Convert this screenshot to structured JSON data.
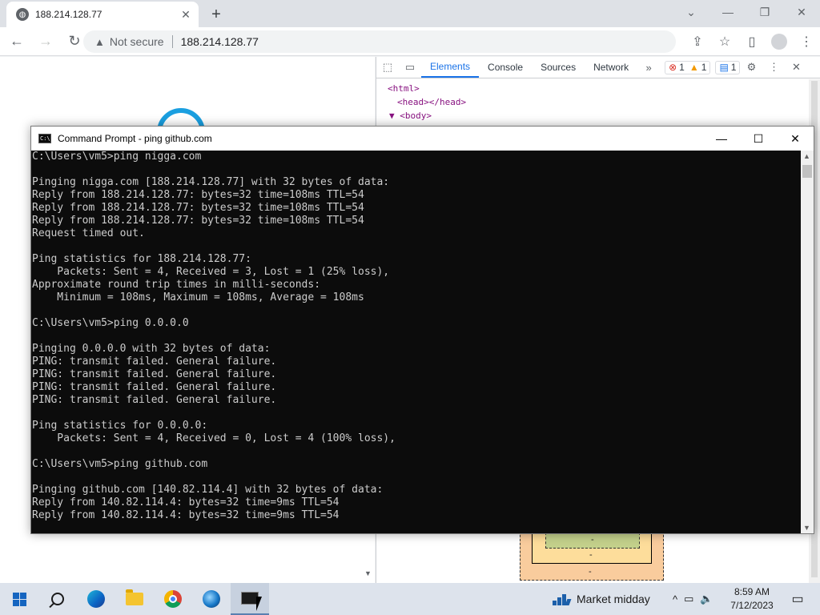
{
  "browser": {
    "tab_title": "188.214.128.77",
    "tab_close_glyph": "✕",
    "new_tab_glyph": "+",
    "window_controls": [
      "⌄",
      "—",
      "❐",
      "✕"
    ],
    "not_secure_label": "Not secure",
    "url": "188.214.128.77",
    "back_glyph": "←",
    "forward_glyph": "→",
    "reload_glyph": "↻",
    "warning_glyph": "▲",
    "toolbar_icons": [
      "share-icon",
      "star-icon",
      "side-panel-icon",
      "profile-icon",
      "menu-icon"
    ]
  },
  "devtools": {
    "tabs": [
      "Elements",
      "Console",
      "Sources",
      "Network"
    ],
    "active_tab": "Elements",
    "more_tabs_glyph": "»",
    "error_count": "1",
    "warning_count": "1",
    "message_count": "1",
    "dom": [
      "<html>",
      "<head></head>",
      "▼ <body>"
    ],
    "boxmodel_dash": "-"
  },
  "cmd": {
    "title": "Command Prompt - ping  github.com",
    "controls": [
      "—",
      "☐",
      "✕"
    ],
    "lines": [
      "C:\\Users\\vm5>ping nigga.com",
      "",
      "Pinging nigga.com [188.214.128.77] with 32 bytes of data:",
      "Reply from 188.214.128.77: bytes=32 time=108ms TTL=54",
      "Reply from 188.214.128.77: bytes=32 time=108ms TTL=54",
      "Reply from 188.214.128.77: bytes=32 time=108ms TTL=54",
      "Request timed out.",
      "",
      "Ping statistics for 188.214.128.77:",
      "    Packets: Sent = 4, Received = 3, Lost = 1 (25% loss),",
      "Approximate round trip times in milli-seconds:",
      "    Minimum = 108ms, Maximum = 108ms, Average = 108ms",
      "",
      "C:\\Users\\vm5>ping 0.0.0.0",
      "",
      "Pinging 0.0.0.0 with 32 bytes of data:",
      "PING: transmit failed. General failure.",
      "PING: transmit failed. General failure.",
      "PING: transmit failed. General failure.",
      "PING: transmit failed. General failure.",
      "",
      "Ping statistics for 0.0.0.0:",
      "    Packets: Sent = 4, Received = 0, Lost = 4 (100% loss),",
      "",
      "C:\\Users\\vm5>ping github.com",
      "",
      "Pinging github.com [140.82.114.4] with 32 bytes of data:",
      "Reply from 140.82.114.4: bytes=32 time=9ms TTL=54",
      "Reply from 140.82.114.4: bytes=32 time=9ms TTL=54"
    ]
  },
  "taskbar": {
    "weather_label": "Market midday",
    "time": "8:59 AM",
    "date": "7/12/2023",
    "tray_glyphs": [
      "^",
      "▭",
      "🔈"
    ],
    "notification_glyph": "▭"
  }
}
